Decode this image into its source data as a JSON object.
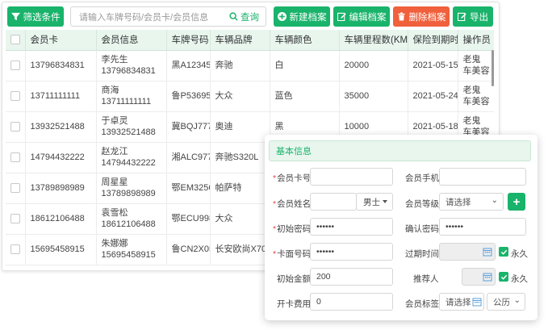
{
  "toolbar": {
    "filter_label": "筛选条件",
    "search_placeholder": "请输入车牌号码/会员卡/会员信息",
    "search_label": "查询",
    "add_label": "新建档案",
    "edit_label": "编辑档案",
    "delete_label": "删除档案",
    "export_label": "导出"
  },
  "table": {
    "headers": [
      "会员卡",
      "会员信息",
      "车牌号码",
      "车辆品牌",
      "车辆颜色",
      "车辆里程数(KM)",
      "保险到期时间",
      "操作员"
    ],
    "rows": [
      {
        "card": "13796834831",
        "name": "李先生",
        "phone": "13796834831",
        "plate": "黑A12345",
        "brand": "奔驰",
        "color": "白",
        "mileage": "20000",
        "insurance": "2021-05-15",
        "op1": "老鬼",
        "op2": "车美容"
      },
      {
        "card": "13711111111",
        "name": "商海",
        "phone": "13711111111",
        "plate": "鲁P53695",
        "brand": "大众",
        "color": "蓝色",
        "mileage": "35000",
        "insurance": "2021-05-24",
        "op1": "老鬼",
        "op2": "车美容"
      },
      {
        "card": "13932521488",
        "name": "于卓灵",
        "phone": "13932521488",
        "plate": "冀BQJ777",
        "brand": "奥迪",
        "color": "黑",
        "mileage": "10000",
        "insurance": "2021-05-18",
        "op1": "老鬼",
        "op2": "车美容"
      },
      {
        "card": "14794432222",
        "name": "赵龙江",
        "phone": "14794432222",
        "plate": "湘ALC977",
        "brand": "奔驰S320L",
        "color": "",
        "mileage": "",
        "insurance": "",
        "op1": "",
        "op2": ""
      },
      {
        "card": "13789898989",
        "name": "周星星",
        "phone": "13789898989",
        "plate": "鄂EM3256",
        "brand": "帕萨特",
        "color": "",
        "mileage": "",
        "insurance": "",
        "op1": "",
        "op2": ""
      },
      {
        "card": "18612106488",
        "name": "袁雪松",
        "phone": "18612106488",
        "plate": "鄂ECU998",
        "brand": "大众",
        "color": "",
        "mileage": "",
        "insurance": "",
        "op1": "",
        "op2": ""
      },
      {
        "card": "15695458915",
        "name": "朱娜娜",
        "phone": "15695458915",
        "plate": "鲁CN2X05",
        "brand": "长安欧尚X70A",
        "color": "",
        "mileage": "",
        "insurance": "",
        "op1": "",
        "op2": ""
      }
    ]
  },
  "form": {
    "title": "基本信息",
    "card_no_label": "会员卡号",
    "mobile_label": "会员手机",
    "name_label": "会员姓名",
    "gender_value": "男士",
    "level_label": "会员等级",
    "level_value": "请选择",
    "init_pwd_label": "初始密码",
    "init_pwd_value": "••••••",
    "confirm_pwd_label": "确认密码",
    "confirm_pwd_value": "••••••",
    "card_pwd_label": "卡面号码",
    "card_pwd_value": "••••••",
    "expire_label": "过期时间",
    "forever_label": "永久",
    "init_amount_label": "初始金额",
    "init_amount_value": "200",
    "referrer_label": "推荐人",
    "forever2_label": "永久",
    "open_fee_label": "开卡费用",
    "open_fee_value": "0",
    "tag_label": "会员标签",
    "tag_value": "请选择",
    "calendar_value": "公历"
  },
  "colors": {
    "primary": "#1ab36b",
    "danger": "#f0603c",
    "header_bg": "#e8f6ee"
  }
}
